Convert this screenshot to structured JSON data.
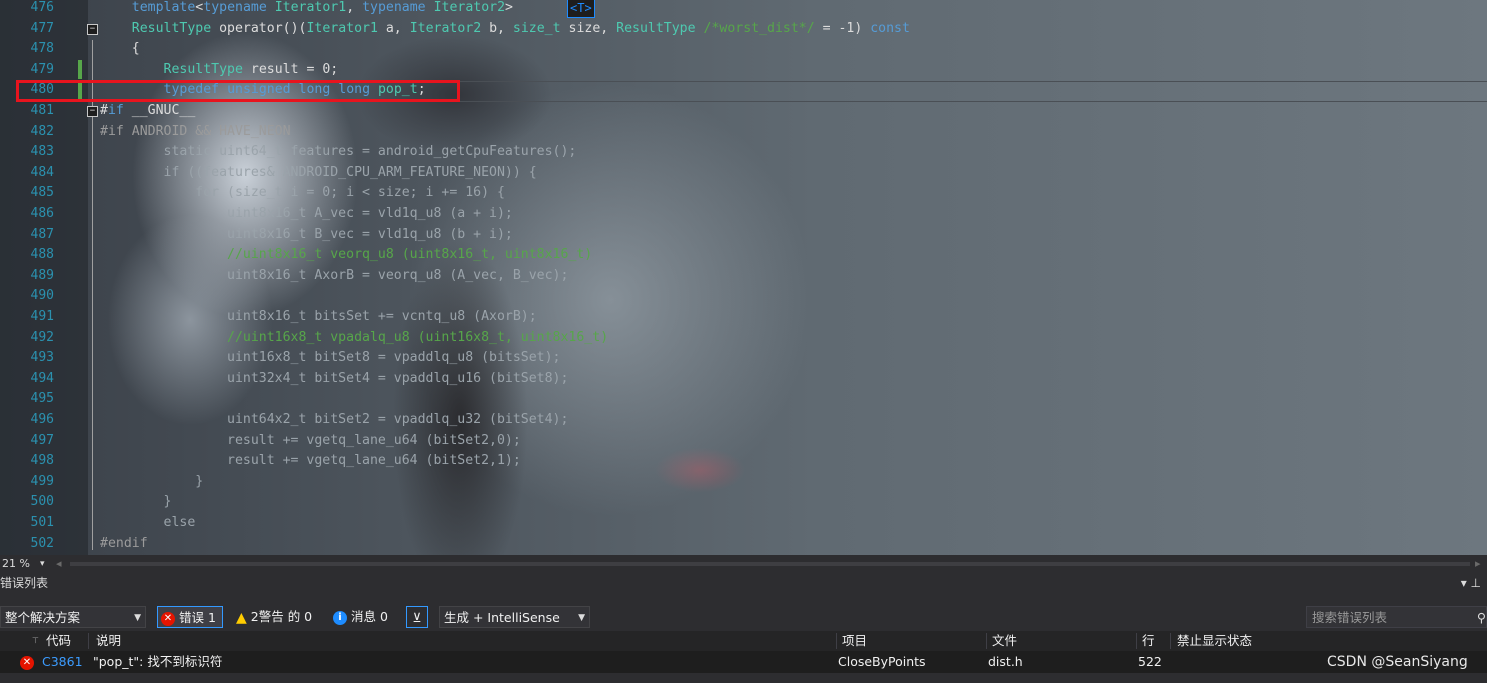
{
  "colors": {
    "keyword": "#569cd6",
    "type": "#4ec9b0",
    "comment": "#57a64a",
    "line_number": "#2b91af",
    "preprocessor": "#9b9b9b",
    "highlight_box": "#e8141e"
  },
  "editor": {
    "badge": "<T>",
    "lines": [
      {
        "n": "476",
        "dim": false,
        "text": "    template<typename Iterator1, typename Iterator2>  "
      },
      {
        "n": "477",
        "dim": false,
        "text": "    ResultType operator()(Iterator1 a, Iterator2 b, size_t size, ResultType /*worst_dist*/ = -1) const"
      },
      {
        "n": "478",
        "dim": false,
        "text": "    {"
      },
      {
        "n": "479",
        "dim": false,
        "text": "        ResultType result = 0;"
      },
      {
        "n": "480",
        "dim": false,
        "text": "        typedef unsigned long long pop_t;"
      },
      {
        "n": "481",
        "dim": false,
        "text": "#if __GNUC__"
      },
      {
        "n": "482",
        "dim": true,
        "text": "#if ANDROID && HAVE_NEON"
      },
      {
        "n": "483",
        "dim": true,
        "text": "        static uint64_t features = android_getCpuFeatures();"
      },
      {
        "n": "484",
        "dim": true,
        "text": "        if ((features& ANDROID_CPU_ARM_FEATURE_NEON)) {"
      },
      {
        "n": "485",
        "dim": true,
        "text": "            for (size_t i = 0; i < size; i += 16) {"
      },
      {
        "n": "486",
        "dim": true,
        "text": "                uint8x16_t A_vec = vld1q_u8 (a + i);"
      },
      {
        "n": "487",
        "dim": true,
        "text": "                uint8x16_t B_vec = vld1q_u8 (b + i);"
      },
      {
        "n": "488",
        "dim": true,
        "text": "                //uint8x16_t veorq_u8 (uint8x16_t, uint8x16_t)"
      },
      {
        "n": "489",
        "dim": true,
        "text": "                uint8x16_t AxorB = veorq_u8 (A_vec, B_vec);"
      },
      {
        "n": "490",
        "dim": true,
        "text": ""
      },
      {
        "n": "491",
        "dim": true,
        "text": "                uint8x16_t bitsSet += vcntq_u8 (AxorB);"
      },
      {
        "n": "492",
        "dim": true,
        "text": "                //uint16x8_t vpadalq_u8 (uint16x8_t, uint8x16_t)"
      },
      {
        "n": "493",
        "dim": true,
        "text": "                uint16x8_t bitSet8 = vpaddlq_u8 (bitsSet);"
      },
      {
        "n": "494",
        "dim": true,
        "text": "                uint32x4_t bitSet4 = vpaddlq_u16 (bitSet8);"
      },
      {
        "n": "495",
        "dim": true,
        "text": ""
      },
      {
        "n": "496",
        "dim": true,
        "text": "                uint64x2_t bitSet2 = vpaddlq_u32 (bitSet4);"
      },
      {
        "n": "497",
        "dim": true,
        "text": "                result += vgetq_lane_u64 (bitSet2,0);"
      },
      {
        "n": "498",
        "dim": true,
        "text": "                result += vgetq_lane_u64 (bitSet2,1);"
      },
      {
        "n": "499",
        "dim": true,
        "text": "            }"
      },
      {
        "n": "500",
        "dim": true,
        "text": "        }"
      },
      {
        "n": "501",
        "dim": true,
        "text": "        else"
      },
      {
        "n": "502",
        "dim": true,
        "text": "#endif"
      }
    ]
  },
  "zoom": {
    "level": "21 %",
    "arrow": "▾"
  },
  "panel": {
    "title": "错误列表",
    "pin_icon": "▾ ⊥",
    "toolbar": {
      "scope": "整个解决方案",
      "errors": "错误 1",
      "warnings": "2警告 的 0",
      "messages": "消息 0",
      "filter_icon": "filter-icon",
      "source": "生成 + IntelliSense",
      "search_placeholder": "搜索错误列表"
    },
    "columns": {
      "code": "代码",
      "desc": "说明",
      "project": "项目",
      "file": "文件",
      "line": "行",
      "suppression": "禁止显示状态"
    },
    "error_row": {
      "code": "C3861",
      "desc": "\"pop_t\": 找不到标识符",
      "project": "CloseByPoints",
      "file": "dist.h",
      "line": "522"
    }
  },
  "watermark": "CSDN @SeanSiyang"
}
